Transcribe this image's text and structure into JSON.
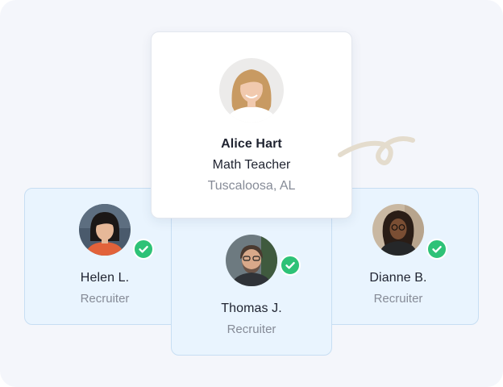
{
  "main_profile": {
    "name": "Alice Hart",
    "title": "Math Teacher",
    "location": "Tuscaloosa, AL"
  },
  "recruiters": [
    {
      "name": "Helen L.",
      "role": "Recruiter",
      "verified": true
    },
    {
      "name": "Thomas J.",
      "role": "Recruiter",
      "verified": true
    },
    {
      "name": "Dianne B.",
      "role": "Recruiter",
      "verified": true
    }
  ],
  "colors": {
    "card_blue": "#e9f4fe",
    "card_border": "#c7def3",
    "verified_badge": "#2ec277",
    "background": "#f4f6fb",
    "squiggle": "#e4dccd"
  },
  "icons": [
    "check-icon",
    "squiggle-decoration"
  ]
}
